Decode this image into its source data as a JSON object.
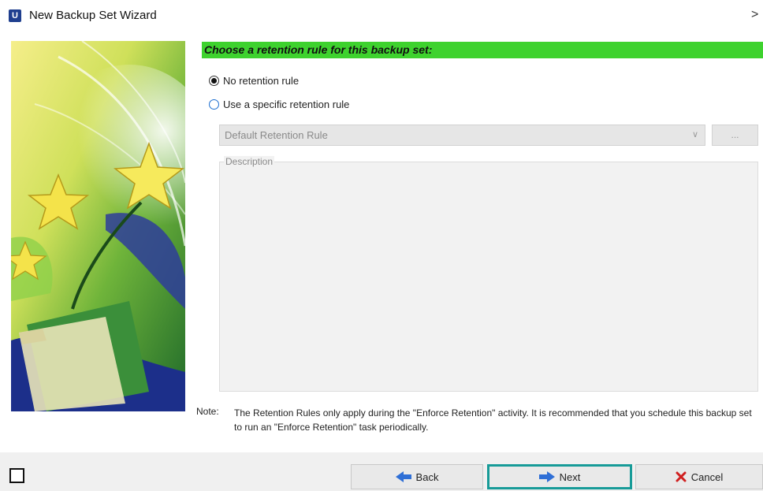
{
  "window": {
    "app_icon_letter": "U",
    "title": "New Backup Set Wizard",
    "close_glyph": ">"
  },
  "step": {
    "header": "Choose a retention rule for this backup set:"
  },
  "options": {
    "no_rule_label": "No retention rule",
    "no_rule_selected": true,
    "specific_rule_label": "Use a specific retention rule",
    "specific_rule_selected": false
  },
  "rule_select": {
    "value": "Default Retention Rule",
    "arrow": "∨",
    "browse_label": "..."
  },
  "description": {
    "label": "Description"
  },
  "note": {
    "label": "Note:",
    "text": "The Retention Rules only apply during the \"Enforce Retention\" activity. It is recommended that you schedule this backup set to run an \"Enforce Retention\" task periodically."
  },
  "buttons": {
    "back": "Back",
    "next": "Next",
    "cancel": "Cancel"
  },
  "colors": {
    "header_green": "#3ed22e",
    "next_focus_border": "#179b98"
  }
}
